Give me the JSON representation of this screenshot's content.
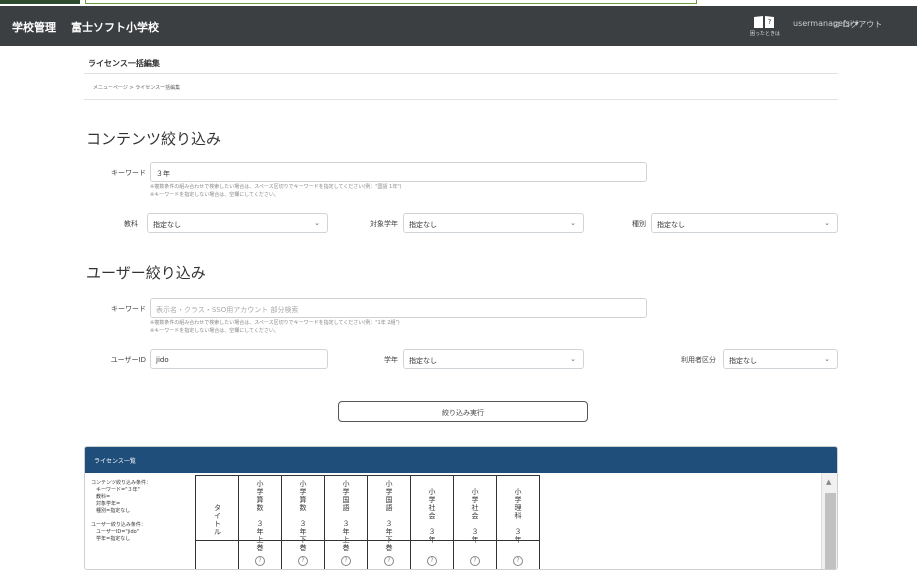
{
  "navbar": {
    "brand": "学校管理",
    "school": "富士ソフト小学校",
    "help_label": "困ったときは",
    "user": "usermanagefsi ▾",
    "logout": "⊡ ログアウト"
  },
  "page": {
    "title": "ライセンス一括編集",
    "breadcrumb": "メニューページ > ライセンス一括編集"
  },
  "content_filter": {
    "heading": "コンテンツ絞り込み",
    "keyword_label": "キーワード",
    "keyword_value": "３年",
    "hint1": "※複数条件の組み合わせで検索したい場合は、スペース区切りでキーワードを指定してください(例：\"国語 1年\")",
    "hint2": "※キーワードを指定しない場合は、空欄にしてください。",
    "subject_label": "教科",
    "subject_value": "指定なし",
    "grade_label": "対象学年",
    "grade_value": "指定なし",
    "type_label": "種別",
    "type_value": "指定なし"
  },
  "user_filter": {
    "heading": "ユーザー絞り込み",
    "keyword_label": "キーワード",
    "keyword_placeholder": "表示名・クラス・SSO用アカウント 部分検索",
    "hint1": "※複数条件の組み合わせで検索したい場合は、スペース区切りでキーワードを指定してください(例：\"1年 2組\")",
    "hint2": "※キーワードを指定しない場合は、空欄にしてください。",
    "userid_label": "ユーザーID",
    "userid_value": "jido",
    "year_label": "学年",
    "year_value": "指定なし",
    "usertype_label": "利用者区分",
    "usertype_value": "指定なし"
  },
  "run_button": "絞り込み実行",
  "license_list": {
    "heading": "ライセンス一覧",
    "conditions": [
      "コンテンツ絞り込み条件：",
      "　キーワード=\"３年\"",
      "　教科=",
      "　対象学年=",
      "　種別=指定なし",
      "",
      "ユーザー絞り込み条件：",
      "　ユーザーID=\"jido\"",
      "　学年=指定なし"
    ],
    "title_col": "タイトル",
    "columns": [
      {
        "top": "小学算数",
        "bottom": "３年上巻"
      },
      {
        "top": "小学算数",
        "bottom": "３年下巻"
      },
      {
        "top": "小学国語",
        "bottom": "３年上巻"
      },
      {
        "top": "小学国語",
        "bottom": "３年下巻"
      },
      {
        "top": "小学社会",
        "bottom": "３年"
      },
      {
        "top": "小学社会",
        "bottom": "３年"
      },
      {
        "top": "小学理科",
        "bottom": "３年"
      }
    ],
    "help_mark": "?"
  }
}
